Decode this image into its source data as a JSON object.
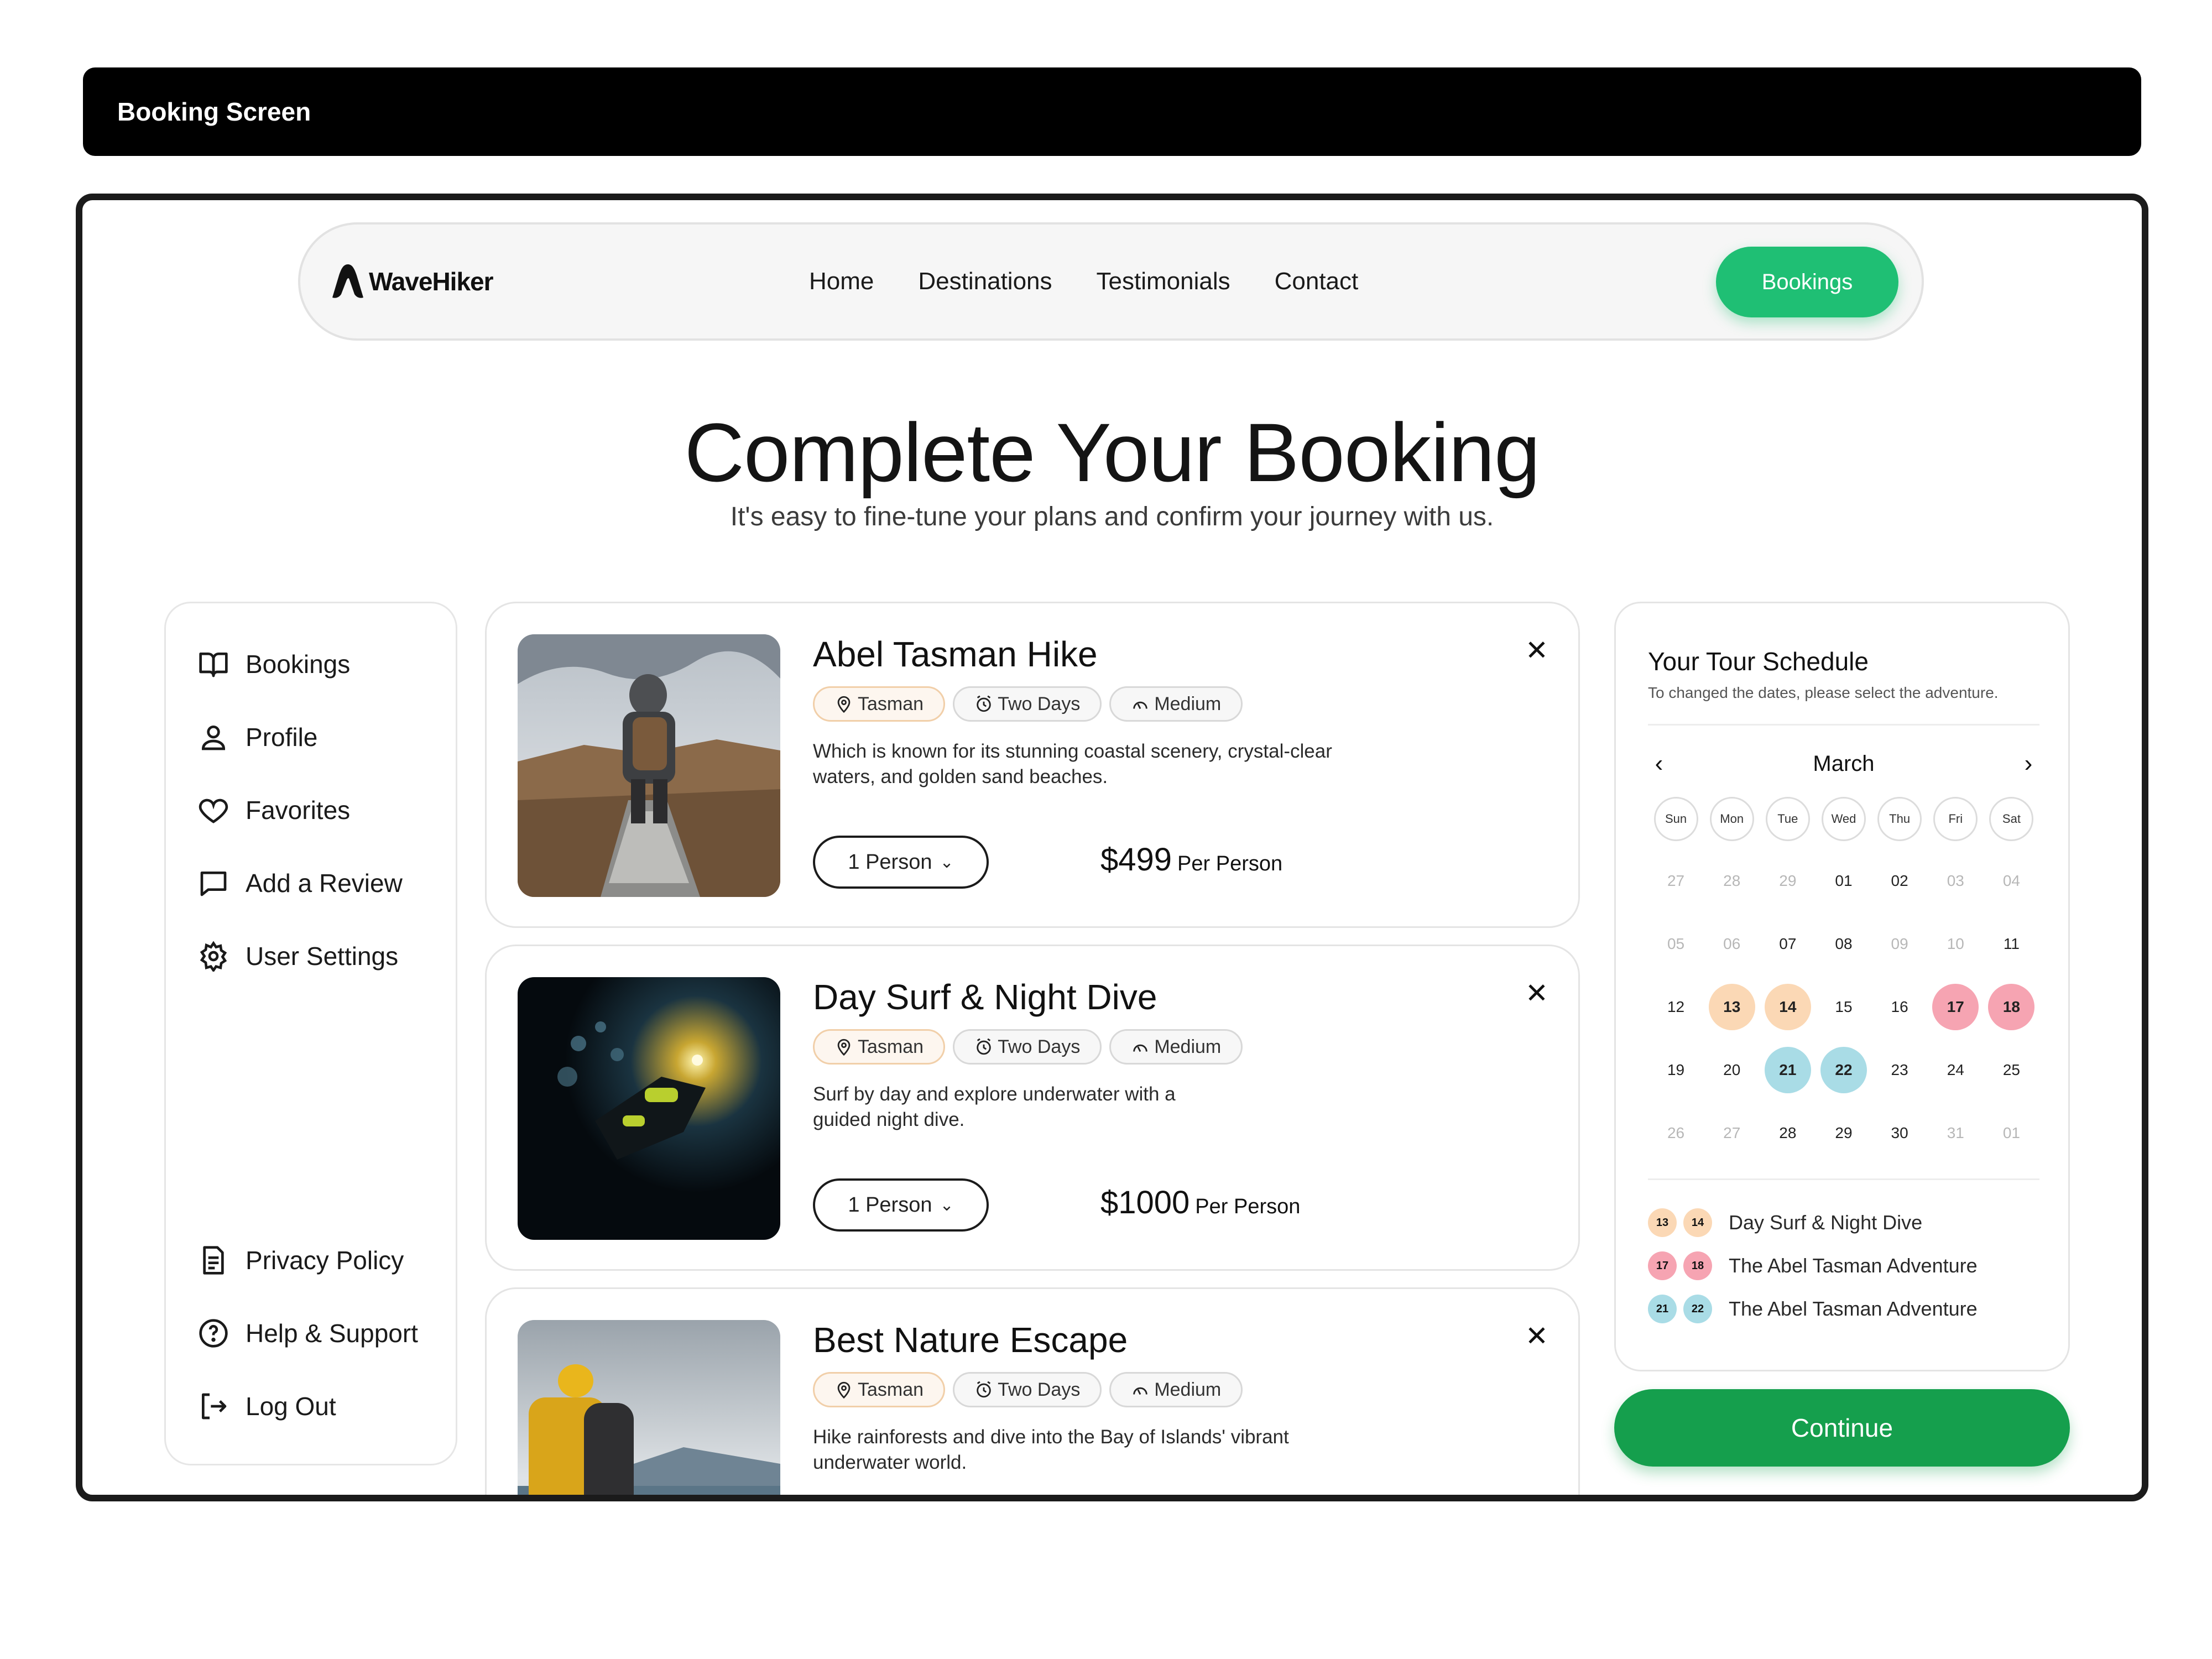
{
  "topbar": {
    "title": "Booking Screen"
  },
  "brand": {
    "name": "WaveHiker"
  },
  "nav": {
    "links": [
      "Home",
      "Destinations",
      "Testimonials",
      "Contact"
    ],
    "cta": "Bookings"
  },
  "hero": {
    "title": "Complete Your Booking",
    "subtitle": "It's easy to fine-tune your plans and confirm your journey with us."
  },
  "sidebar": {
    "top_items": [
      {
        "label": "Bookings",
        "icon": "book-icon"
      },
      {
        "label": "Profile",
        "icon": "user-icon"
      },
      {
        "label": "Favorites",
        "icon": "heart-icon"
      },
      {
        "label": "Add a Review",
        "icon": "chat-icon"
      },
      {
        "label": "User Settings",
        "icon": "gear-icon"
      }
    ],
    "bottom_items": [
      {
        "label": "Privacy Policy",
        "icon": "document-icon"
      },
      {
        "label": "Help & Support",
        "icon": "help-icon"
      },
      {
        "label": "Log Out",
        "icon": "logout-icon"
      }
    ]
  },
  "tours": [
    {
      "title": "Abel Tasman Hike",
      "tags": [
        "Tasman",
        "Two Days",
        "Medium"
      ],
      "description": "Which is known for its stunning coastal scenery, crystal-clear waters, and golden sand beaches.",
      "persons": "1 Person",
      "price": "$499",
      "price_unit": "Per Person"
    },
    {
      "title": "Day Surf & Night Dive",
      "tags": [
        "Tasman",
        "Two Days",
        "Medium"
      ],
      "description": "Surf by day and explore underwater with a guided night dive.",
      "persons": "1 Person",
      "price": "$1000",
      "price_unit": "Per Person"
    },
    {
      "title": "Best Nature Escape",
      "tags": [
        "Tasman",
        "Two Days",
        "Medium"
      ],
      "description": "Hike rainforests and dive into the Bay of Islands' vibrant underwater world."
    }
  ],
  "schedule": {
    "title": "Your Tour Schedule",
    "subtitle": "To changed the dates, please select the adventure.",
    "month": "March",
    "weekdays": [
      "Sun",
      "Mon",
      "Tue",
      "Wed",
      "Thu",
      "Fri",
      "Sat"
    ],
    "days": [
      {
        "d": "27",
        "s": "muted"
      },
      {
        "d": "28",
        "s": "muted"
      },
      {
        "d": "29",
        "s": "muted"
      },
      {
        "d": "01",
        "s": ""
      },
      {
        "d": "02",
        "s": ""
      },
      {
        "d": "03",
        "s": "muted"
      },
      {
        "d": "04",
        "s": "muted"
      },
      {
        "d": "05",
        "s": "muted"
      },
      {
        "d": "06",
        "s": "muted"
      },
      {
        "d": "07",
        "s": ""
      },
      {
        "d": "08",
        "s": ""
      },
      {
        "d": "09",
        "s": "muted"
      },
      {
        "d": "10",
        "s": "muted"
      },
      {
        "d": "11",
        "s": ""
      },
      {
        "d": "12",
        "s": ""
      },
      {
        "d": "13",
        "s": "orange"
      },
      {
        "d": "14",
        "s": "orange"
      },
      {
        "d": "15",
        "s": ""
      },
      {
        "d": "16",
        "s": ""
      },
      {
        "d": "17",
        "s": "pink"
      },
      {
        "d": "18",
        "s": "pink"
      },
      {
        "d": "19",
        "s": ""
      },
      {
        "d": "20",
        "s": ""
      },
      {
        "d": "21",
        "s": "blue"
      },
      {
        "d": "22",
        "s": "blue"
      },
      {
        "d": "23",
        "s": ""
      },
      {
        "d": "24",
        "s": ""
      },
      {
        "d": "25",
        "s": ""
      },
      {
        "d": "26",
        "s": "muted"
      },
      {
        "d": "27",
        "s": "muted"
      },
      {
        "d": "28",
        "s": ""
      },
      {
        "d": "29",
        "s": ""
      },
      {
        "d": "30",
        "s": ""
      },
      {
        "d": "31",
        "s": "muted"
      },
      {
        "d": "01",
        "s": "muted"
      }
    ],
    "legend": [
      {
        "dates": [
          "13",
          "14"
        ],
        "color": "#fbd8b5",
        "label": "Day Surf & Night Dive"
      },
      {
        "dates": [
          "17",
          "18"
        ],
        "color": "#f6a4b2",
        "label": "The Abel Tasman Adventure"
      },
      {
        "dates": [
          "21",
          "22"
        ],
        "color": "#a9dce6",
        "label": "The Abel Tasman Adventure"
      }
    ]
  },
  "continue_label": "Continue",
  "colors": {
    "accent": "#1fbf74",
    "continue": "#159f4d"
  }
}
